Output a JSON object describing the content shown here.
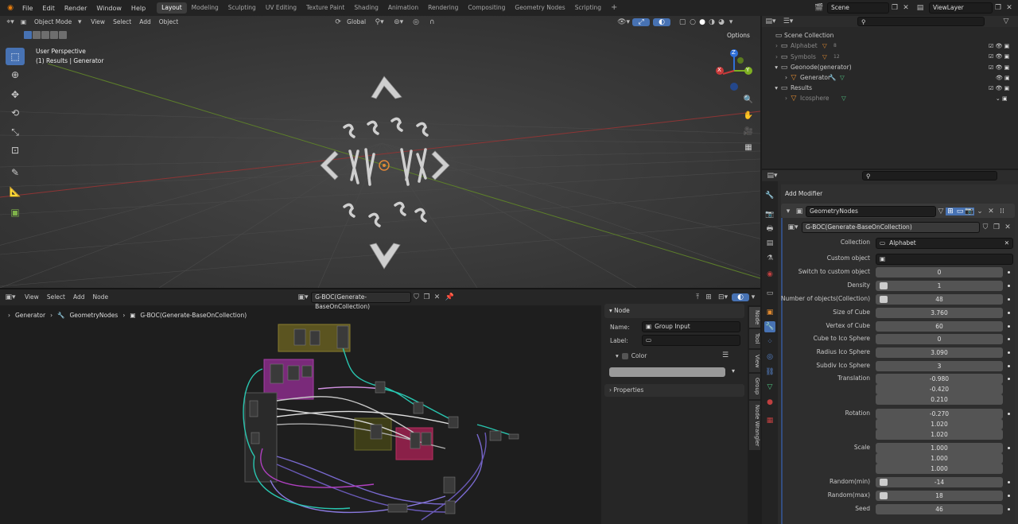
{
  "topbar": {
    "menus": [
      "File",
      "Edit",
      "Render",
      "Window",
      "Help"
    ],
    "workspaces": [
      "Layout",
      "Modeling",
      "Sculpting",
      "UV Editing",
      "Texture Paint",
      "Shading",
      "Animation",
      "Rendering",
      "Compositing",
      "Geometry Nodes",
      "Scripting"
    ],
    "add": "+",
    "scene": "Scene",
    "view_layer": "ViewLayer"
  },
  "viewport": {
    "mode": "Object Mode",
    "menus": [
      "View",
      "Select",
      "Add",
      "Object"
    ],
    "transform": "Global",
    "options": "Options",
    "overlay_line1": "User Perspective",
    "overlay_line2": "(1) Results | Generator",
    "gizmo_x": "X",
    "gizmo_y": "Y",
    "gizmo_z": "Z"
  },
  "node_editor": {
    "menus": [
      "View",
      "Select",
      "Add",
      "Node"
    ],
    "tree_name": "G-BOC(Generate-BaseOnCollection)",
    "breadcrumb": [
      "Generator",
      "GeometryNodes",
      "G-BOC(Generate-BaseOnCollection)"
    ],
    "panel_node": "Node",
    "name_label": "Name:",
    "name_value": "Group Input",
    "label_label": "Label:",
    "color_label": "Color",
    "properties_label": "Properties",
    "tabs": [
      "Node",
      "Tool",
      "View",
      "Group",
      "Node Wrangler"
    ]
  },
  "outliner": {
    "root": "Scene Collection",
    "rows": [
      {
        "name": "Alphabet",
        "badge": "8"
      },
      {
        "name": "Symbols",
        "badge": "12"
      },
      {
        "name": "Geonode(generator)",
        "badge": ""
      },
      {
        "name": "Generator",
        "badge": ""
      },
      {
        "name": "Results",
        "badge": ""
      },
      {
        "name": "Icosphere",
        "badge": ""
      }
    ]
  },
  "properties": {
    "add_modifier": "Add Modifier",
    "modifier_name": "GeometryNodes",
    "group_name": "G-BOC(Generate-BaseOnCollection)",
    "collection_label": "Collection",
    "collection_value": "Alphabet",
    "custom_object_label": "Custom object",
    "fields": [
      {
        "label": "Switch to custom object",
        "value": "0"
      },
      {
        "label": "Density",
        "value": "1"
      },
      {
        "label": "Number of objects(Collection)",
        "value": "48"
      },
      {
        "label": "Size of Cube",
        "value": "3.760"
      },
      {
        "label": "Vertex of Cube",
        "value": "60"
      },
      {
        "label": "Cube to Ico Sphere",
        "value": "0"
      },
      {
        "label": "Radius Ico Sphere",
        "value": "3.090"
      },
      {
        "label": "Subdiv Ico Sphere",
        "value": "3"
      }
    ],
    "translation_label": "Translation",
    "translation": [
      "-0.980",
      "-0.420",
      "0.210"
    ],
    "rotation_label": "Rotation",
    "rotation": [
      "-0.270",
      "1.020",
      "1.020"
    ],
    "scale_label": "Scale",
    "scale": [
      "1.000",
      "1.000",
      "1.000"
    ],
    "tail": [
      {
        "label": "Random(min)",
        "value": "-14"
      },
      {
        "label": "Random(max)",
        "value": "18"
      },
      {
        "label": "Seed",
        "value": "46"
      }
    ]
  },
  "colors": {
    "accent": "#4772b3",
    "selected_header": "#334d80",
    "x_axis": "#a33b3b",
    "y_axis": "#6e9a2e"
  }
}
